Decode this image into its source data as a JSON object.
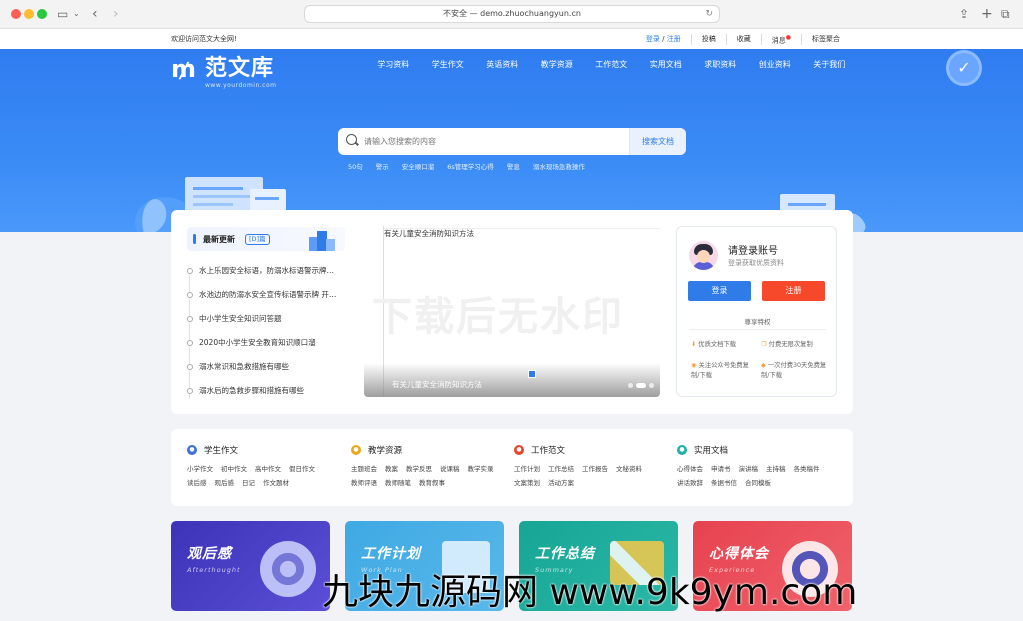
{
  "browser": {
    "url": "不安全 — demo.zhuochuangyun.cn"
  },
  "topbar": {
    "welcome": "欢迎访问范文大全网!",
    "login": "登录",
    "slash": "/",
    "register": "注册",
    "links": [
      "投稿",
      "收藏",
      "消息",
      "标签聚合"
    ]
  },
  "header": {
    "logo_text": "范文库",
    "logo_sub": "www.yourdomin.com",
    "nav": [
      "学习资料",
      "学生作文",
      "英语资料",
      "教学资源",
      "工作范文",
      "实用文档",
      "求职资料",
      "创业资料",
      "关于我们"
    ]
  },
  "search": {
    "placeholder": "请输入您搜索的内容",
    "button": "搜索文档",
    "hot_tags": [
      "50句",
      "警示",
      "安全顺口溜",
      "6s管理学习心得",
      "警息",
      "溺水现场急救操作"
    ]
  },
  "latest": {
    "title": "最新更新",
    "badge": "[D]篇",
    "items": [
      "水上乐园安全标语，防溺水标语警示牌…",
      "水池边的防溺水安全宣传标语警示牌 开…",
      "中小学生安全知识问答题",
      "2020中小学生安全教育知识顺口溜",
      "溺水常识和急救措施有哪些",
      "溺水后的急救步骤和措施有哪些"
    ]
  },
  "slider": {
    "top_caption": "有关儿童安全消防知识方法",
    "watermark": "下载后无水印",
    "caption": "有关儿童安全消防知识方法"
  },
  "login": {
    "title": "请登录账号",
    "subtitle": "登录获取优质资料",
    "login_button": "登录",
    "register_button": "注册",
    "vip_title": "尊享特权",
    "perks": [
      "优质文档下载",
      "付费无限次复制",
      "关注公众号免费复制/下载",
      "一次付费30天免费复制/下载"
    ]
  },
  "categories": [
    {
      "name": "学生作文",
      "color": "#3d6fd9",
      "links": [
        "小学作文",
        "初中作文",
        "高中作文",
        "假日作文",
        "读后感",
        "观后感",
        "日记",
        "作文题材"
      ]
    },
    {
      "name": "教学资源",
      "color": "#e8a91a",
      "links": [
        "主题班会",
        "教案",
        "教学反思",
        "说课稿",
        "教学实录",
        "教师评语",
        "教师随笔",
        "教育叙事"
      ]
    },
    {
      "name": "工作范文",
      "color": "#e2472e",
      "links": [
        "工作计划",
        "工作总结",
        "工作报告",
        "文秘资料",
        "文案策划",
        "活动方案"
      ]
    },
    {
      "name": "实用文档",
      "color": "#1fb0a8",
      "links": [
        "心得体会",
        "申请书",
        "演讲稿",
        "主持稿",
        "各类稿件",
        "讲话致辞",
        "条据书信",
        "合同模板"
      ]
    }
  ],
  "tiles": [
    {
      "title": "观后感",
      "sub": "Afterthought",
      "bg": "#4a3fc6"
    },
    {
      "title": "工作计划",
      "sub": "Work Plan",
      "bg": "#3ea0e0"
    },
    {
      "title": "工作总结",
      "sub": "Summary",
      "bg": "#1fa899"
    },
    {
      "title": "心得体会",
      "sub": "Experience",
      "bg": "#ea4a55"
    }
  ],
  "site_watermark": "九块九源码网 www.9k9ym.com"
}
